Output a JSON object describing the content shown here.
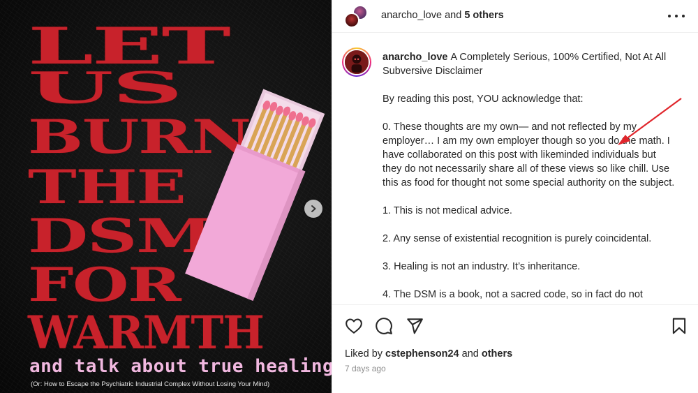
{
  "poster": {
    "lines": [
      "LET",
      "US",
      "BURN",
      "THE",
      "DSM",
      "FOR",
      "WARMTH"
    ],
    "subtitle": "and talk about true healing",
    "tagline": "(Or: How to Escape the Psychiatric Industrial Complex Without Losing Your Mind)",
    "title_color": "#c8222b",
    "subtitle_color": "#f1b8e0",
    "matchbox_color": "#f2a9d8",
    "next_icon": "chevron-right-icon"
  },
  "header": {
    "username": "anarcho_love",
    "joiner": " and ",
    "collaborators": "5 others",
    "more_icon": "more-horizontal-icon"
  },
  "caption": {
    "username": "anarcho_love",
    "title": "A Completely Serious, 100% Certified, Not At All Subversive Disclaimer",
    "paragraphs": [
      "By reading this post, YOU acknowledge that:",
      "0. These thoughts are my own— and not reflected by my employer… I am my own employer though so you do the math. I have collaborated on this post with likeminded individuals but they do not necessarily share all of these views so like chill. Use this as food for thought not some special authority on the subject.",
      "1. This is not medical advice.",
      "2. Any sense of existential recognition is purely coincidental.",
      "3. Healing is not an industry. It’s inheritance.",
      "4. The DSM is a book, not a sacred code, so in fact do not"
    ],
    "annotation_color": "#e0252b"
  },
  "actions": {
    "icons": [
      "heart-icon",
      "comment-icon",
      "share-icon",
      "bookmark-icon"
    ],
    "liked_prefix": "Liked by ",
    "liked_user": "cstephenson24",
    "liked_joiner": " and ",
    "liked_others": "others",
    "time_ago": "7 days ago"
  }
}
